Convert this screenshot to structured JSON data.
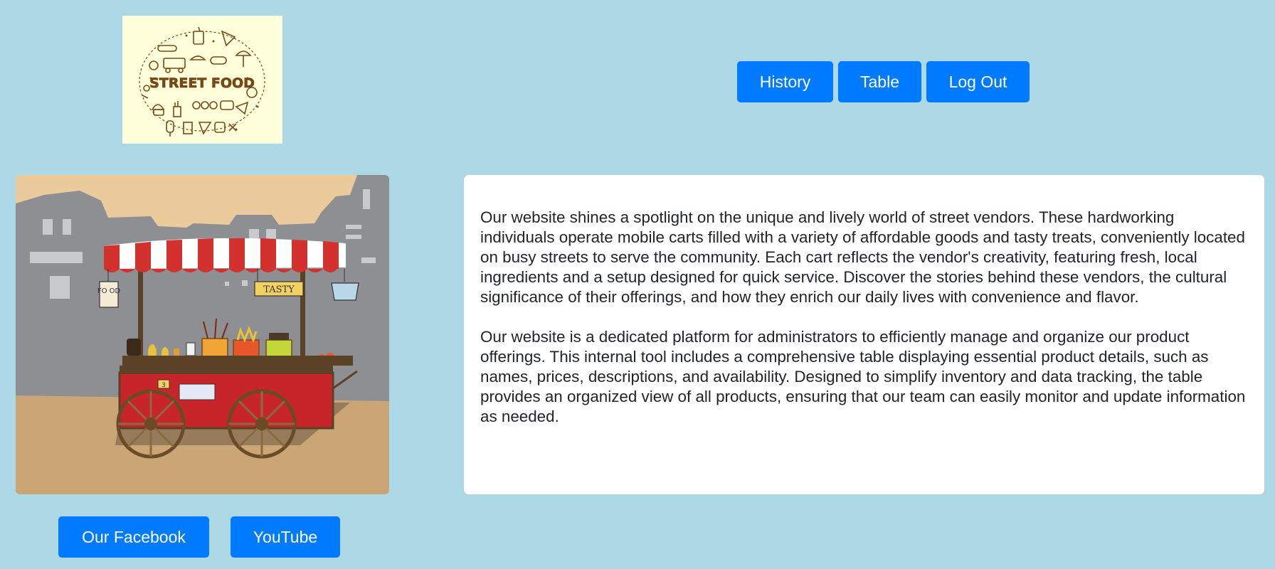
{
  "logo": {
    "text": "STREET FOOD"
  },
  "nav": {
    "history_label": "History",
    "table_label": "Table",
    "logout_label": "Log Out"
  },
  "hero": {
    "sign_food": "FO OD",
    "sign_tasty": "TASTY",
    "cart_number": "3"
  },
  "card": {
    "paragraph_1": "Our website shines a spotlight on the unique and lively world of street vendors. These hardworking individuals operate mobile carts filled with a variety of affordable goods and tasty treats, conveniently located on busy streets to serve the community. Each cart reflects the vendor's creativity, featuring fresh, local ingredients and a setup designed for quick service. Discover the stories behind these vendors, the cultural significance of their offerings, and how they enrich our daily lives with convenience and flavor.",
    "paragraph_2": "Our website is a dedicated platform for administrators to efficiently manage and organize our product offerings. This internal tool includes a comprehensive table displaying essential product details, such as names, prices, descriptions, and availability. Designed to simplify inventory and data tracking, the table provides an organized view of all products, ensuring that our team can easily monitor and update information as needed."
  },
  "social": {
    "facebook_label": "Our Facebook",
    "youtube_label": "YouTube"
  },
  "colors": {
    "page_background": "#add8e6",
    "button_primary": "#007bff",
    "logo_background": "#ffffdc",
    "logo_ink": "#7a4a12"
  }
}
